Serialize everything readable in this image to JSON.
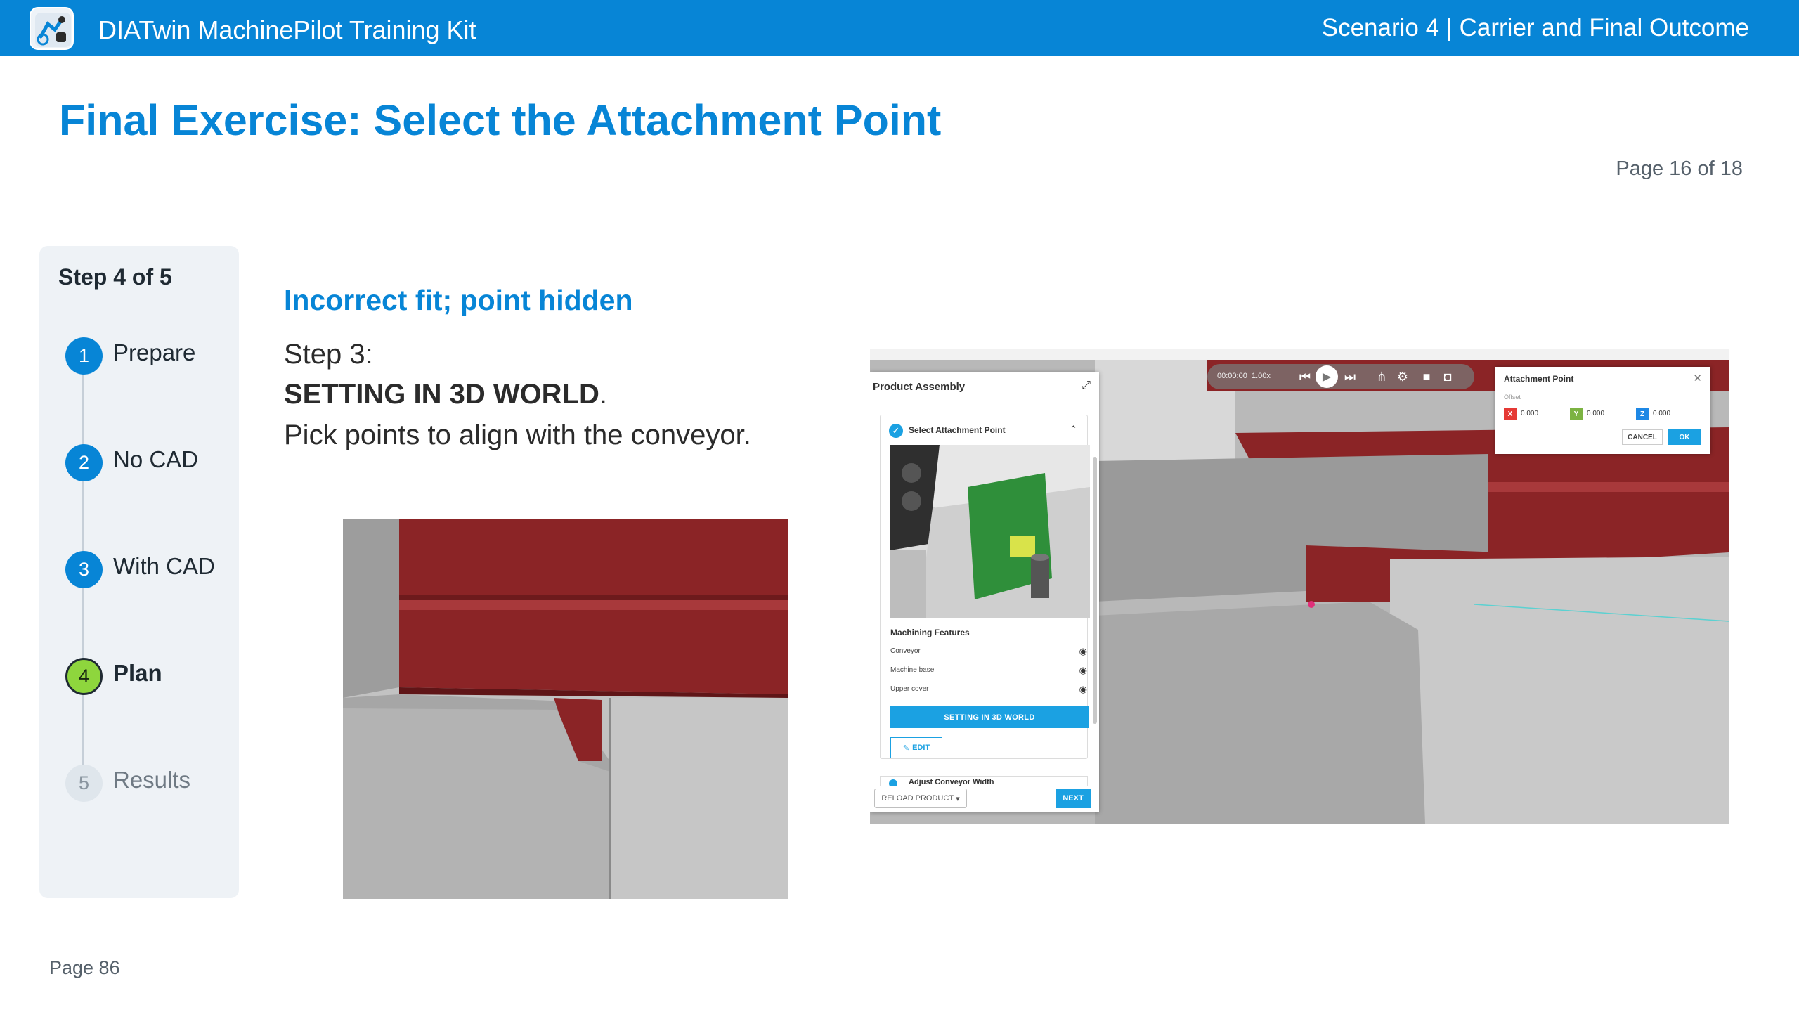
{
  "header": {
    "app_title": "DIATwin MachinePilot Training Kit",
    "scenario": "Scenario 4 | Carrier and Final Outcome",
    "brand_color": "#0785d6"
  },
  "page": {
    "title": "Final Exercise: Select the Attachment Point",
    "counter": "Page 16 of 18",
    "footer": "Page 86"
  },
  "sidebar": {
    "title": "Step 4 of 5",
    "steps": [
      {
        "number": "1",
        "label": "Prepare",
        "state": "done"
      },
      {
        "number": "2",
        "label": "No CAD",
        "state": "done"
      },
      {
        "number": "3",
        "label": "With CAD",
        "state": "done"
      },
      {
        "number": "4",
        "label": "Plan",
        "state": "current"
      },
      {
        "number": "5",
        "label": "Results",
        "state": "pending"
      }
    ],
    "current_color": "#8ed63d"
  },
  "content": {
    "subtitle": "Incorrect fit; point hidden",
    "line1": "Step 3:",
    "line2_bold": "SETTING IN 3D WORLD",
    "line2_suffix": ".",
    "line3": "Pick points to align with the conveyor."
  },
  "screenshot": {
    "panel": {
      "title": "Product Assembly",
      "section_title": "Select Attachment Point",
      "features_title": "Machining Features",
      "features": [
        {
          "label": "Conveyor",
          "icon": "eye-icon"
        },
        {
          "label": "Machine base",
          "icon": "eye-icon"
        },
        {
          "label": "Upper cover",
          "icon": "eye-icon"
        }
      ],
      "setting_button": "SETTING IN 3D WORLD",
      "edit_button": "EDIT",
      "next_section": "Adjust Conveyor Width",
      "reload_button": "RELOAD PRODUCT",
      "next_button": "NEXT"
    },
    "toolbar": {
      "time_label": "00:00:00",
      "speed": "1.00x",
      "icons": [
        "skip-back-icon",
        "play-icon",
        "step-icon",
        "network-icon",
        "settings-icon",
        "video-icon",
        "camera-icon"
      ]
    },
    "attachment_dialog": {
      "title": "Attachment Point",
      "offset_label": "Offset",
      "x_label": "X",
      "x_value": "0.000",
      "y_label": "Y",
      "y_value": "0.000",
      "z_label": "Z",
      "z_value": "0.000",
      "cancel": "CANCEL",
      "ok": "OK",
      "x_color": "#e53935",
      "y_color": "#7cb342",
      "z_color": "#1e88e5"
    },
    "accent_color": "#1ba1e2",
    "model_red": "#8b2426"
  }
}
